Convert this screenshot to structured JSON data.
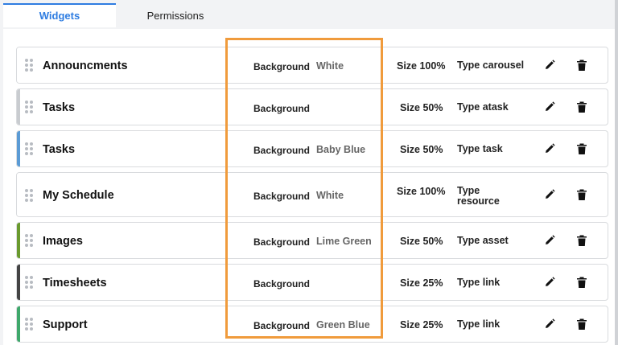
{
  "tabs": [
    {
      "label": "Widgets",
      "active": true
    },
    {
      "label": "Permissions",
      "active": false
    }
  ],
  "background_label": "Background",
  "widgets": [
    {
      "name": "Announcments",
      "background": "White",
      "size": "Size 100%",
      "type": "Type carousel",
      "accent": "#ffffff"
    },
    {
      "name": "Tasks",
      "background": "",
      "size": "Size 50%",
      "type": "Type atask",
      "accent": "#c9ccd0"
    },
    {
      "name": "Tasks",
      "background": "Baby Blue",
      "size": "Size 50%",
      "type": "Type task",
      "accent": "#5b9bd5"
    },
    {
      "name": "My Schedule",
      "background": "White",
      "size": "Size 100%",
      "type": "Type resource",
      "accent": "#ffffff"
    },
    {
      "name": "Images",
      "background": "Lime Green",
      "size": "Size 50%",
      "type": "Type asset",
      "accent": "#6a9a2e"
    },
    {
      "name": "Timesheets",
      "background": "",
      "size": "Size 25%",
      "type": "Type link",
      "accent": "#444444"
    },
    {
      "name": "Support",
      "background": "Green Blue",
      "size": "Size 25%",
      "type": "Type link",
      "accent": "#3fa86b"
    }
  ],
  "icons": {
    "edit": "pencil-icon",
    "delete": "trash-icon",
    "drag": "drag-handle-icon"
  },
  "highlight_color": "#f09b3c"
}
